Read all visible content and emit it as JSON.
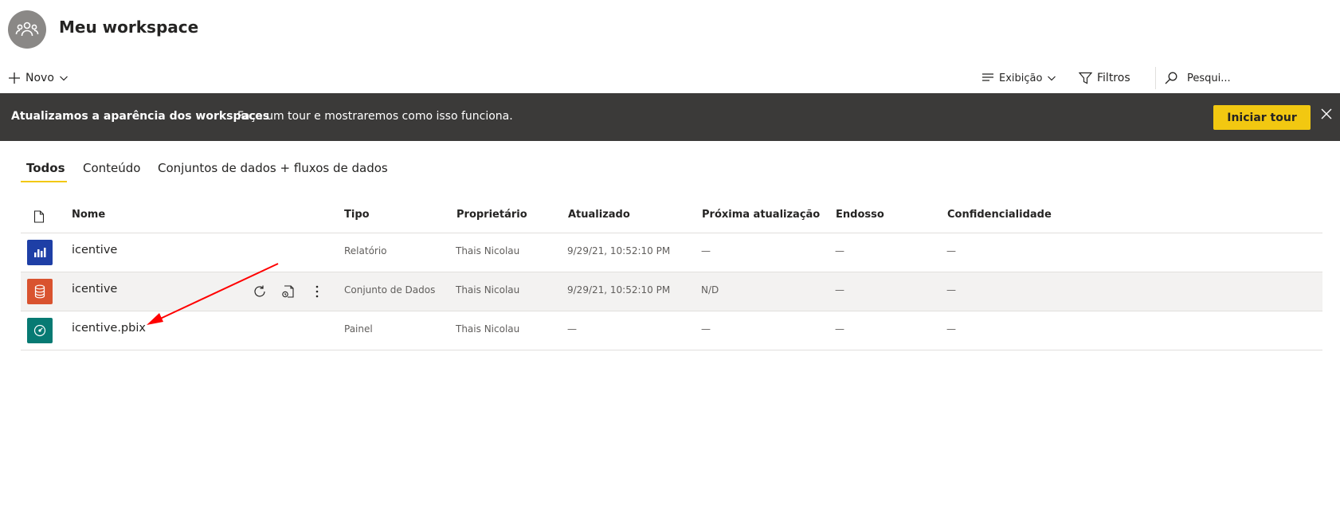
{
  "workspace": {
    "title": "Meu workspace",
    "avatar_icon": "people-group-icon"
  },
  "toolbar": {
    "new_label": "Novo",
    "view_label": "Exibição",
    "filters_label": "Filtros",
    "search_placeholder": "Pesqui..."
  },
  "banner": {
    "title": "Atualizamos a aparência dos workspaces",
    "text": "Faça um tour e mostraremos como isso funciona.",
    "button_label": "Iniciar tour",
    "button_color": "#F2C811",
    "background": "#3B3A39"
  },
  "tabs": [
    {
      "label": "Todos",
      "active": true
    },
    {
      "label": "Conteúdo",
      "active": false
    },
    {
      "label": "Conjuntos de dados + fluxos de dados",
      "active": false
    }
  ],
  "table": {
    "headers": {
      "name": "Nome",
      "type": "Tipo",
      "owner": "Proprietário",
      "updated": "Atualizado",
      "next_refresh": "Próxima atualização",
      "endorsement": "Endosso",
      "sensitivity": "Confidencialidade"
    },
    "rows": [
      {
        "icon": "report-bar-chart-icon",
        "icon_color": "#1E3FA6",
        "name": "icentive",
        "type": "Relatório",
        "owner": "Thais Nicolau",
        "updated": "9/29/21, 10:52:10 PM",
        "next_refresh": "—",
        "endorsement": "—",
        "sensitivity": "—"
      },
      {
        "icon": "dataset-database-icon",
        "icon_color": "#D9532F",
        "name": "icentive",
        "type": "Conjunto de Dados",
        "owner": "Thais Nicolau",
        "updated": "9/29/21, 10:52:10 PM",
        "next_refresh": "N/D",
        "endorsement": "—",
        "sensitivity": "—"
      },
      {
        "icon": "dashboard-gauge-icon",
        "icon_color": "#077A73",
        "name": "icentive.pbix",
        "type": "Painel",
        "owner": "Thais Nicolau",
        "updated": "—",
        "next_refresh": "—",
        "endorsement": "—",
        "sensitivity": "—"
      }
    ]
  },
  "annotation": {
    "arrow_color": "#FF0000"
  }
}
